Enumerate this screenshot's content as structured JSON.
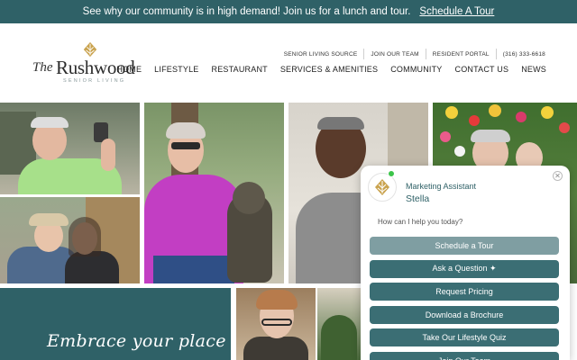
{
  "topbar": {
    "message": "See why our community is in high demand! Join us for a lunch and tour.",
    "cta": "Schedule A Tour"
  },
  "logo": {
    "the": "The",
    "name": "Rushwood",
    "sub": "SENIOR LIVING"
  },
  "utility_nav": [
    "SENIOR LIVING SOURCE",
    "JOIN OUR TEAM",
    "RESIDENT PORTAL",
    "(316) 333-6618"
  ],
  "main_nav": [
    "HOME",
    "LIFESTYLE",
    "RESTAURANT",
    "SERVICES & AMENITIES",
    "COMMUNITY",
    "CONTACT US",
    "NEWS"
  ],
  "welcome": {
    "script_text": "Embrace your place"
  },
  "chat": {
    "role": "Marketing Assistant",
    "agent": "Stella",
    "prompt": "How can I help you today?",
    "buttons": [
      "Schedule a Tour",
      "Ask a Question ✦",
      "Request Pricing",
      "Download a Brochure",
      "Take Our Lifestyle Quiz",
      "Join Our Team"
    ]
  },
  "colors": {
    "teal": "#2f6167",
    "button": "#3b6e74",
    "button_muted": "#7f9ea2",
    "gold": "#c9a24d",
    "online": "#3cc44a"
  },
  "icons": {
    "logo": "gold-leaf-icon",
    "chat_avatar": "gold-leaf-icon",
    "close": "close-icon",
    "status": "online-dot-icon"
  }
}
